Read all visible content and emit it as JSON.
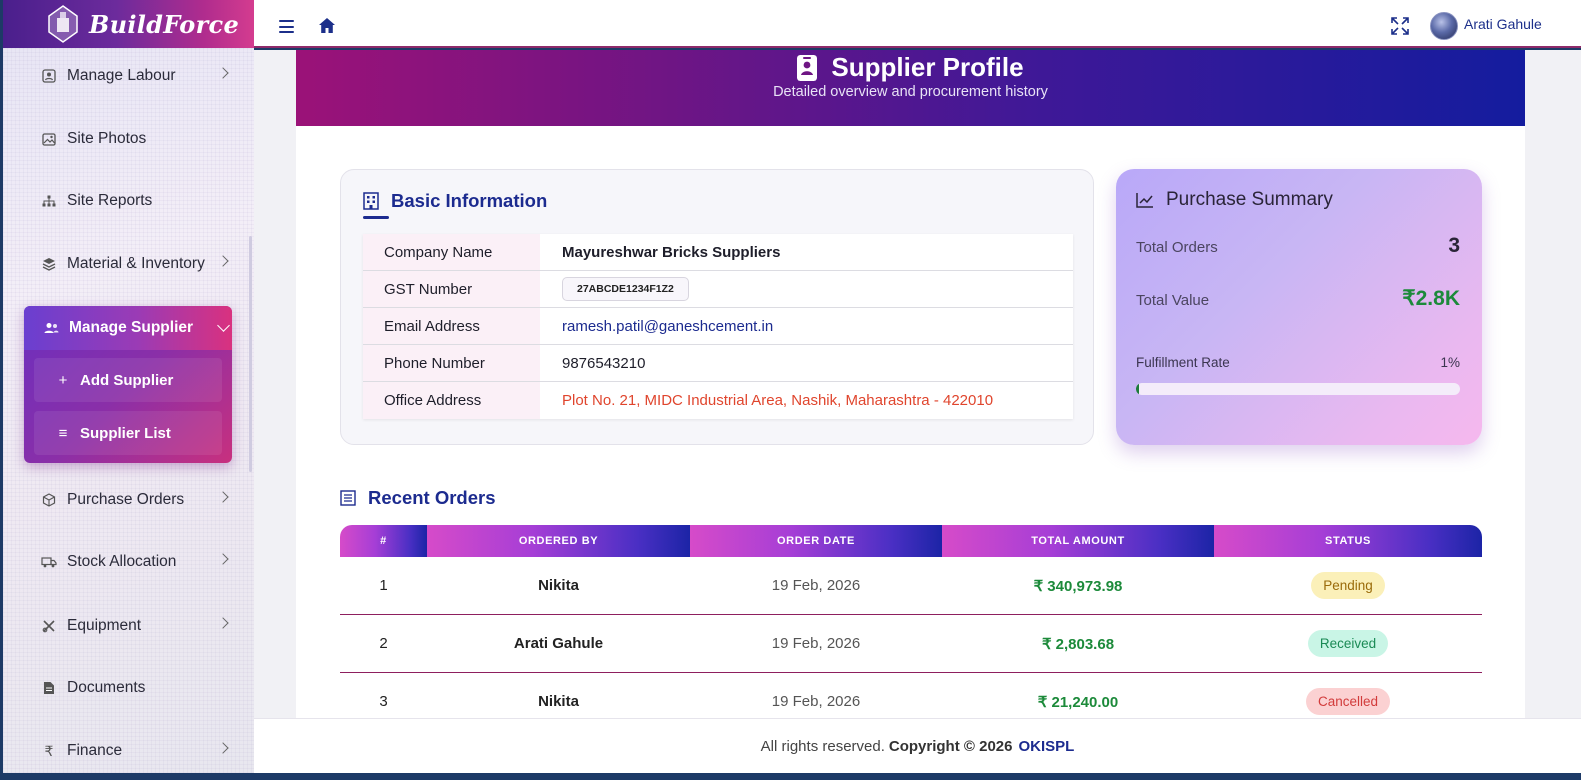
{
  "app": {
    "brand": "BuildForce",
    "accent": "#1c2b8f"
  },
  "sidebar": {
    "items": [
      {
        "label": "Manage Labour",
        "icon": "id-badge-icon"
      },
      {
        "label": "Site Photos",
        "icon": "image-icon"
      },
      {
        "label": "Site Reports",
        "icon": "sitemap-icon"
      },
      {
        "label": "Material & Inventory",
        "icon": "layers-icon"
      },
      {
        "label": "Manage Supplier",
        "icon": "users-icon"
      },
      {
        "label": "Purchase Orders",
        "icon": "box-icon"
      },
      {
        "label": "Stock Allocation",
        "icon": "truck-icon"
      },
      {
        "label": "Equipment",
        "icon": "tools-icon"
      },
      {
        "label": "Documents",
        "icon": "file-icon"
      },
      {
        "label": "Finance",
        "icon": "rupee-icon"
      }
    ],
    "supplier_sub": [
      {
        "label": "Add Supplier",
        "symbol": "+"
      },
      {
        "label": "Supplier List",
        "symbol": "≡"
      }
    ]
  },
  "topbar": {
    "username": "Arati Gahule"
  },
  "hero": {
    "title": "Supplier Profile",
    "subtitle": "Detailed overview and procurement history"
  },
  "basic": {
    "title": "Basic Information",
    "rows": [
      {
        "key": "Company Name",
        "value": "Mayureshwar Bricks Suppliers"
      },
      {
        "key": "GST Number",
        "value": "27ABCDE1234F1Z2"
      },
      {
        "key": "Email Address",
        "value": "ramesh.patil@ganeshcement.in"
      },
      {
        "key": "Phone Number",
        "value": "9876543210"
      },
      {
        "key": "Office Address",
        "value": "Plot No. 21, MIDC Industrial Area, Nashik, Maharashtra - 422010"
      }
    ]
  },
  "summary": {
    "title": "Purchase Summary",
    "total_orders_label": "Total Orders",
    "total_orders": "3",
    "total_value_label": "Total Value",
    "total_value": "₹2.8K",
    "fulfillment_label": "Fulfillment Rate",
    "fulfillment_pct": "1%",
    "fulfillment_fraction": 0.01,
    "value_color": "#1c8a3a"
  },
  "orders": {
    "title": "Recent Orders",
    "headers": [
      "#",
      "ORDERED BY",
      "ORDER DATE",
      "TOTAL AMOUNT",
      "STATUS"
    ],
    "rows": [
      {
        "n": "1",
        "by": "Nikita",
        "date": "19 Feb, 2026",
        "amount": "₹ 340,973.98",
        "status": "Pending"
      },
      {
        "n": "2",
        "by": "Arati Gahule",
        "date": "19 Feb, 2026",
        "amount": "₹ 2,803.68",
        "status": "Received"
      },
      {
        "n": "3",
        "by": "Nikita",
        "date": "19 Feb, 2026",
        "amount": "₹ 21,240.00",
        "status": "Cancelled"
      }
    ]
  },
  "footer": {
    "text": "All rights reserved.",
    "copyright": "Copyright © 2026",
    "company": "OKISPL"
  }
}
